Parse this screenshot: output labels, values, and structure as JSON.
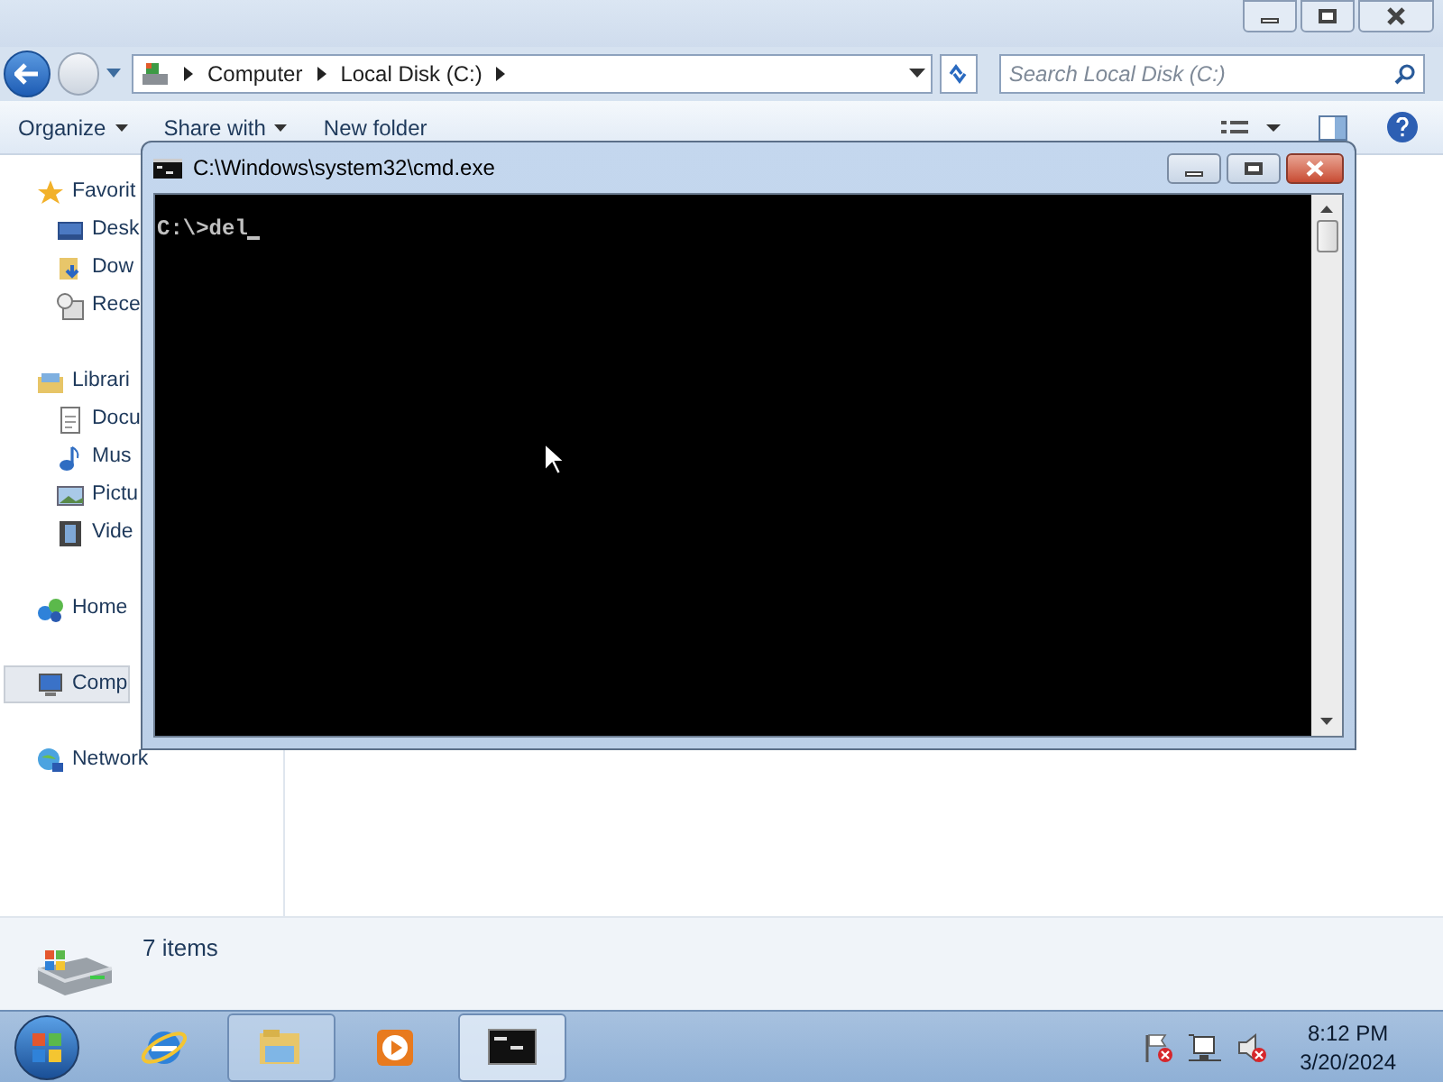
{
  "explorer": {
    "breadcrumb": [
      "Computer",
      "Local Disk (C:)"
    ],
    "search": {
      "placeholder": "Search Local Disk (C:)"
    },
    "toolbar": [
      {
        "label": "Organize",
        "dropdown": true
      },
      {
        "label": "Share with",
        "dropdown": true
      },
      {
        "label": "New folder",
        "dropdown": false
      }
    ],
    "nav": [
      {
        "label": "Favorit",
        "kind": "favorites",
        "selected": false,
        "children": [
          {
            "label": "Desk",
            "kind": "desktop",
            "selected": false
          },
          {
            "label": "Dow",
            "kind": "downloads",
            "selected": false
          },
          {
            "label": "Rece",
            "kind": "recent",
            "selected": false
          }
        ]
      },
      {
        "label": "Librari",
        "kind": "libraries",
        "selected": false,
        "children": [
          {
            "label": "Docu",
            "kind": "documents",
            "selected": false
          },
          {
            "label": "Mus",
            "kind": "music",
            "selected": false
          },
          {
            "label": "Pictu",
            "kind": "pictures",
            "selected": false
          },
          {
            "label": "Vide",
            "kind": "videos",
            "selected": false
          }
        ]
      },
      {
        "label": "Home",
        "kind": "homegroup",
        "selected": false
      },
      {
        "label": "Comp",
        "kind": "computer",
        "selected": true
      },
      {
        "label": "Network",
        "kind": "network",
        "selected": false
      }
    ],
    "status_bar": {
      "text": "7 items"
    }
  },
  "cmd": {
    "title": "C:\\Windows\\system32\\cmd.exe",
    "lines": [
      "C:\\>del"
    ],
    "cursor": true
  },
  "taskbar": {
    "items": [
      {
        "kind": "ie",
        "running": false,
        "selected": false
      },
      {
        "kind": "explorer",
        "running": true,
        "selected": false
      },
      {
        "kind": "media",
        "running": false,
        "selected": false
      },
      {
        "kind": "cmd",
        "running": true,
        "selected": true
      }
    ],
    "clock": {
      "time": "8:12 PM",
      "date": "3/20/2024"
    }
  }
}
